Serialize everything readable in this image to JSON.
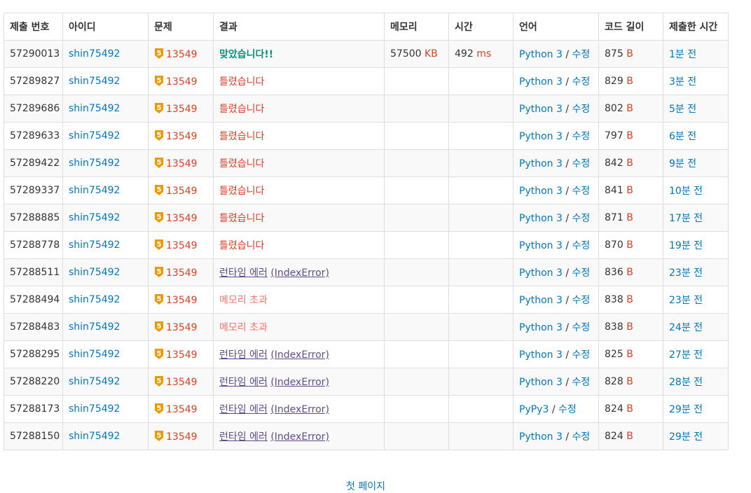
{
  "headers": [
    "제출 번호",
    "아이디",
    "문제",
    "결과",
    "메모리",
    "시간",
    "언어",
    "코드 길이",
    "제출한 시간"
  ],
  "rows": [
    {
      "id": "57290013",
      "user": "shin75492",
      "problem": "13549",
      "result": "맞았습니다!!",
      "result_type": "ac",
      "result_extra": "",
      "memory": "57500",
      "memory_unit": "KB",
      "time": "492",
      "time_unit": "ms",
      "lang": "Python 3",
      "edit": "수정",
      "len": "875",
      "len_unit": "B",
      "when": "1분 전"
    },
    {
      "id": "57289827",
      "user": "shin75492",
      "problem": "13549",
      "result": "틀렸습니다",
      "result_type": "wa",
      "result_extra": "",
      "memory": "",
      "memory_unit": "",
      "time": "",
      "time_unit": "",
      "lang": "Python 3",
      "edit": "수정",
      "len": "829",
      "len_unit": "B",
      "when": "3분 전"
    },
    {
      "id": "57289686",
      "user": "shin75492",
      "problem": "13549",
      "result": "틀렸습니다",
      "result_type": "wa",
      "result_extra": "",
      "memory": "",
      "memory_unit": "",
      "time": "",
      "time_unit": "",
      "lang": "Python 3",
      "edit": "수정",
      "len": "802",
      "len_unit": "B",
      "when": "5분 전"
    },
    {
      "id": "57289633",
      "user": "shin75492",
      "problem": "13549",
      "result": "틀렸습니다",
      "result_type": "wa",
      "result_extra": "",
      "memory": "",
      "memory_unit": "",
      "time": "",
      "time_unit": "",
      "lang": "Python 3",
      "edit": "수정",
      "len": "797",
      "len_unit": "B",
      "when": "6분 전"
    },
    {
      "id": "57289422",
      "user": "shin75492",
      "problem": "13549",
      "result": "틀렸습니다",
      "result_type": "wa",
      "result_extra": "",
      "memory": "",
      "memory_unit": "",
      "time": "",
      "time_unit": "",
      "lang": "Python 3",
      "edit": "수정",
      "len": "842",
      "len_unit": "B",
      "when": "9분 전"
    },
    {
      "id": "57289337",
      "user": "shin75492",
      "problem": "13549",
      "result": "틀렸습니다",
      "result_type": "wa",
      "result_extra": "",
      "memory": "",
      "memory_unit": "",
      "time": "",
      "time_unit": "",
      "lang": "Python 3",
      "edit": "수정",
      "len": "841",
      "len_unit": "B",
      "when": "10분 전"
    },
    {
      "id": "57288885",
      "user": "shin75492",
      "problem": "13549",
      "result": "틀렸습니다",
      "result_type": "wa",
      "result_extra": "",
      "memory": "",
      "memory_unit": "",
      "time": "",
      "time_unit": "",
      "lang": "Python 3",
      "edit": "수정",
      "len": "871",
      "len_unit": "B",
      "when": "17분 전"
    },
    {
      "id": "57288778",
      "user": "shin75492",
      "problem": "13549",
      "result": "틀렸습니다",
      "result_type": "wa",
      "result_extra": "",
      "memory": "",
      "memory_unit": "",
      "time": "",
      "time_unit": "",
      "lang": "Python 3",
      "edit": "수정",
      "len": "870",
      "len_unit": "B",
      "when": "19분 전"
    },
    {
      "id": "57288511",
      "user": "shin75492",
      "problem": "13549",
      "result": "런타임 에러",
      "result_type": "rte",
      "result_extra": "(IndexError)",
      "memory": "",
      "memory_unit": "",
      "time": "",
      "time_unit": "",
      "lang": "Python 3",
      "edit": "수정",
      "len": "836",
      "len_unit": "B",
      "when": "23분 전"
    },
    {
      "id": "57288494",
      "user": "shin75492",
      "problem": "13549",
      "result": "메모리 초과",
      "result_type": "mle",
      "result_extra": "",
      "memory": "",
      "memory_unit": "",
      "time": "",
      "time_unit": "",
      "lang": "Python 3",
      "edit": "수정",
      "len": "838",
      "len_unit": "B",
      "when": "23분 전"
    },
    {
      "id": "57288483",
      "user": "shin75492",
      "problem": "13549",
      "result": "메모리 초과",
      "result_type": "mle",
      "result_extra": "",
      "memory": "",
      "memory_unit": "",
      "time": "",
      "time_unit": "",
      "lang": "Python 3",
      "edit": "수정",
      "len": "838",
      "len_unit": "B",
      "when": "24분 전"
    },
    {
      "id": "57288295",
      "user": "shin75492",
      "problem": "13549",
      "result": "런타임 에러",
      "result_type": "rte",
      "result_extra": "(IndexError)",
      "memory": "",
      "memory_unit": "",
      "time": "",
      "time_unit": "",
      "lang": "Python 3",
      "edit": "수정",
      "len": "825",
      "len_unit": "B",
      "when": "27분 전"
    },
    {
      "id": "57288220",
      "user": "shin75492",
      "problem": "13549",
      "result": "런타임 에러",
      "result_type": "rte",
      "result_extra": "(IndexError)",
      "memory": "",
      "memory_unit": "",
      "time": "",
      "time_unit": "",
      "lang": "Python 3",
      "edit": "수정",
      "len": "828",
      "len_unit": "B",
      "when": "28분 전"
    },
    {
      "id": "57288173",
      "user": "shin75492",
      "problem": "13549",
      "result": "런타임 에러",
      "result_type": "rte",
      "result_extra": "(IndexError)",
      "memory": "",
      "memory_unit": "",
      "time": "",
      "time_unit": "",
      "lang": "PyPy3",
      "edit": "수정",
      "len": "824",
      "len_unit": "B",
      "when": "29분 전"
    },
    {
      "id": "57288150",
      "user": "shin75492",
      "problem": "13549",
      "result": "런타임 에러",
      "result_type": "rte",
      "result_extra": "(IndexError)",
      "memory": "",
      "memory_unit": "",
      "time": "",
      "time_unit": "",
      "lang": "Python 3",
      "edit": "수정",
      "len": "824",
      "len_unit": "B",
      "when": "29분 전"
    }
  ],
  "tier": {
    "label": "5",
    "icon": "gold-tier-badge-icon",
    "color": "#ec9a00"
  },
  "pager": {
    "first_page": "첫 페이지"
  },
  "colors": {
    "link": "#0076c0",
    "ac": "#009874",
    "wa": "#dd4124",
    "mle": "#fa7268",
    "rte": "#5f4b8b"
  }
}
